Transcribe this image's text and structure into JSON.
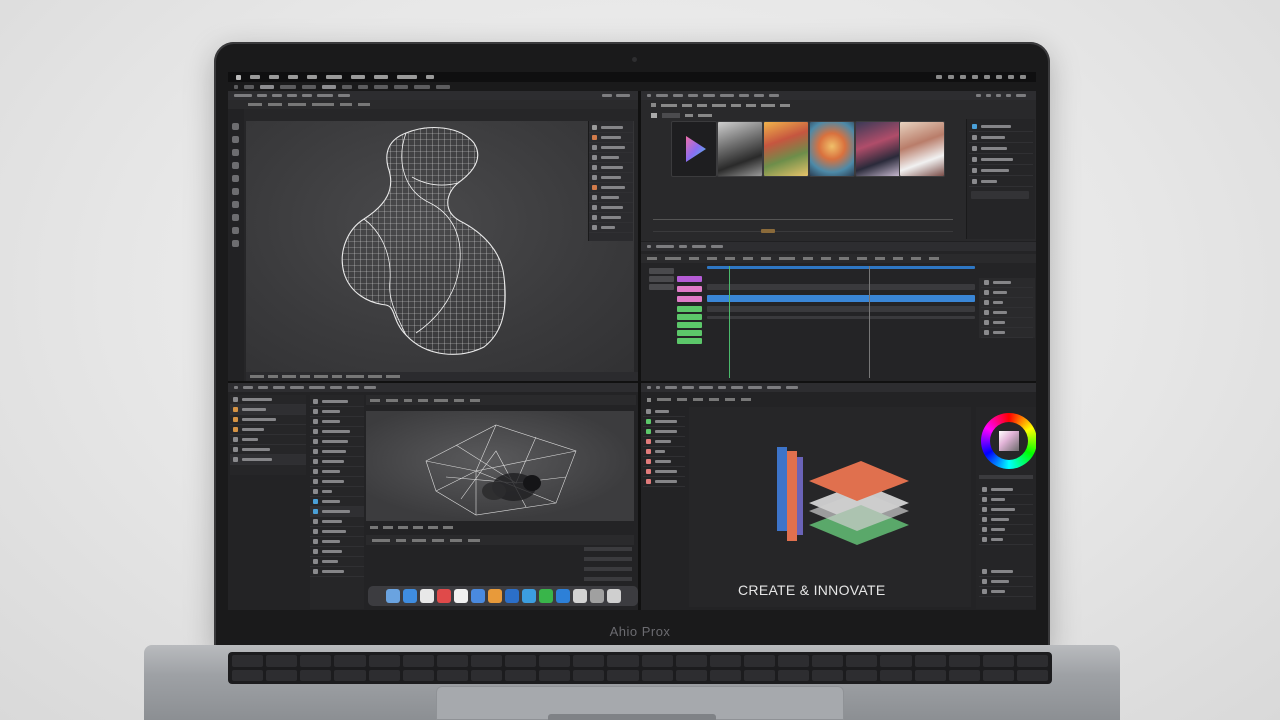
{
  "device": {
    "brand_label": "Ahio Prox"
  },
  "logo_tagline": "CREATE & INNOVATE",
  "colors": {
    "screen_bg": "#202022",
    "timeline_blue": "#3a86d6",
    "clip_purple": "#b55cd6",
    "clip_pink": "#e07bc8",
    "clip_green": "#5cc76a",
    "logo_orange": "#e0704e",
    "logo_blue": "#3d74c9",
    "logo_green": "#5aa86a"
  },
  "icons": [
    "play-icon",
    "color-wheel-icon",
    "trash-icon",
    "finder-icon",
    "safari-icon"
  ]
}
